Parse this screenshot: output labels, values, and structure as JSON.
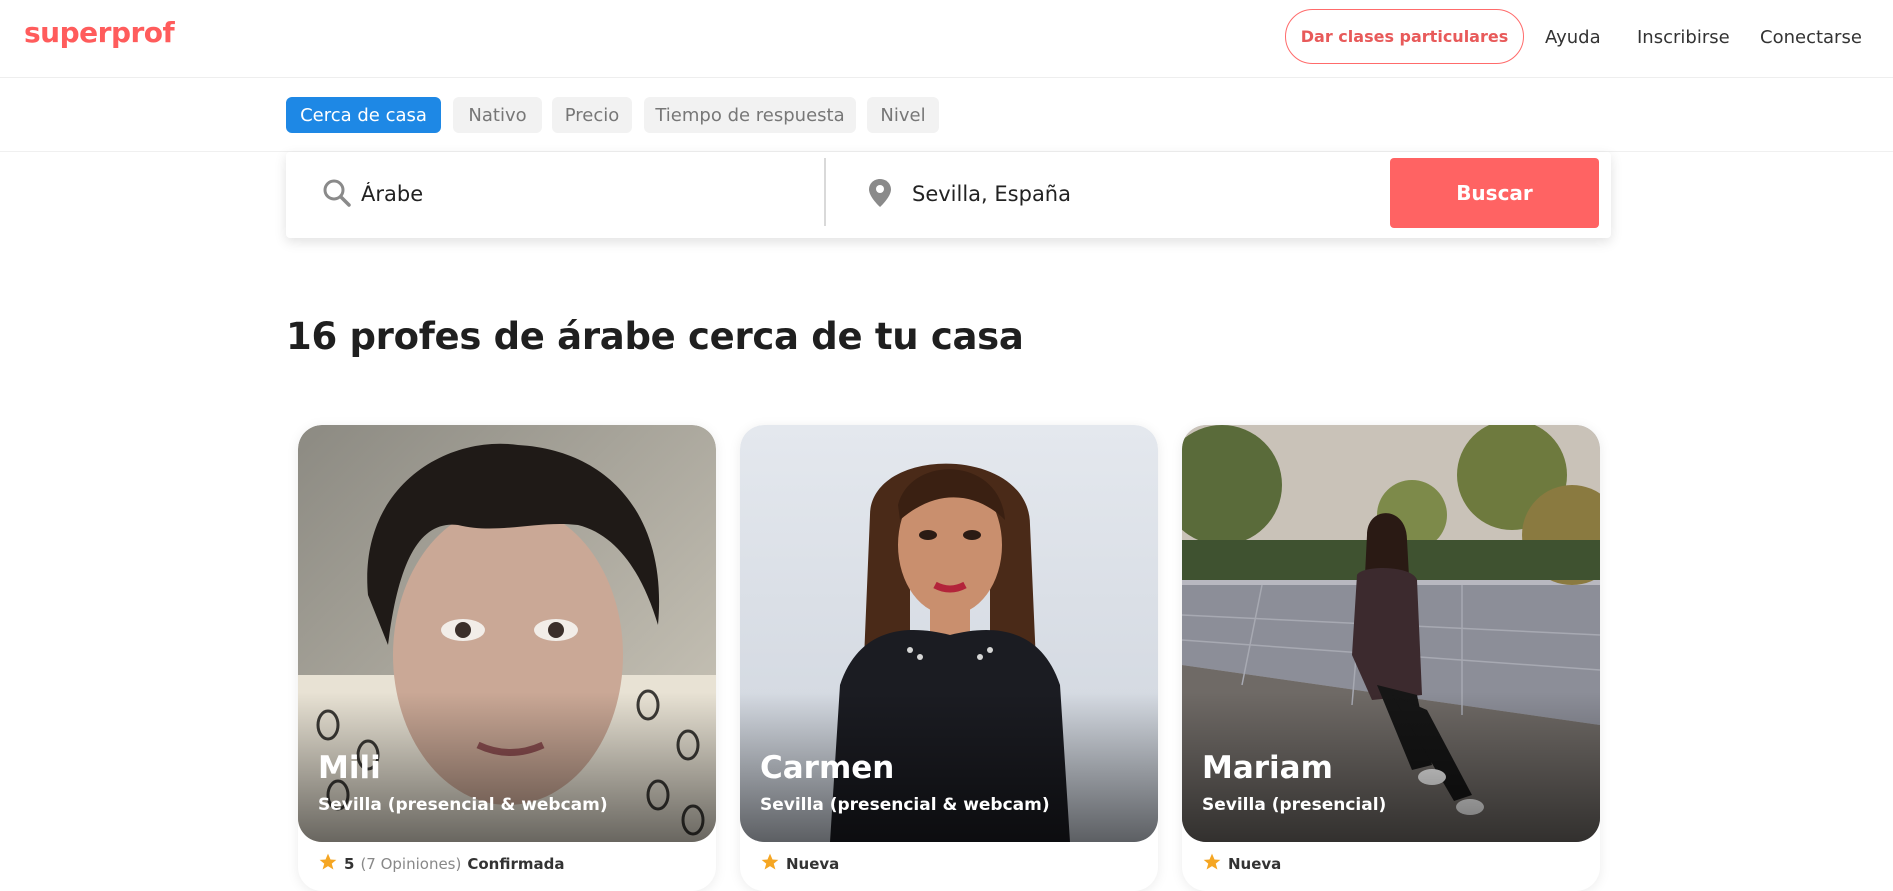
{
  "header": {
    "logo": "superprof",
    "teach_button": "Dar clases particulares",
    "nav": [
      "Ayuda",
      "Inscribirse",
      "Conectarse"
    ]
  },
  "filters": {
    "chips": [
      "Cerca de casa",
      "Nativo",
      "Precio",
      "Tiempo de respuesta",
      "Nivel"
    ]
  },
  "search": {
    "subject_value": "Árabe",
    "location_value": "Sevilla, España",
    "button_label": "Buscar"
  },
  "main": {
    "title": "16 profes de árabe cerca de tu casa"
  },
  "cards": [
    {
      "name": "Mili",
      "location": "Sevilla (presencial & webcam)",
      "rating": "5",
      "reviews": "(7 Opiniones)",
      "status": "Confirmada"
    },
    {
      "name": "Carmen",
      "location": "Sevilla (presencial & webcam)",
      "status": "Nueva"
    },
    {
      "name": "Mariam",
      "location": "Sevilla (presencial)",
      "status": "Nueva"
    }
  ],
  "colors": {
    "brand": "#ff5c5c",
    "active_chip": "#1e88e5",
    "search_button": "#ff6363",
    "star": "#f5a623"
  }
}
